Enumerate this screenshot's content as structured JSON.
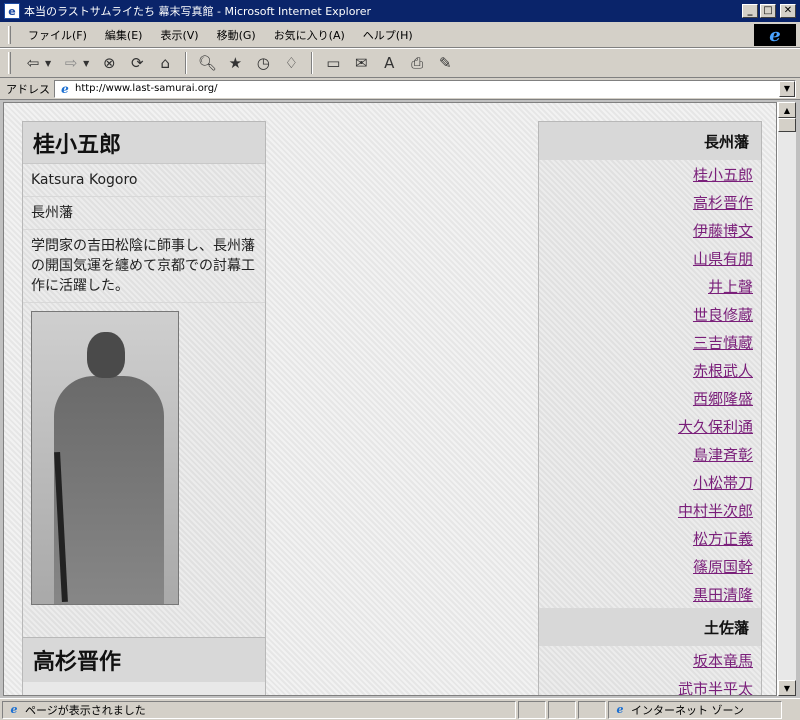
{
  "window": {
    "title": "本当のラストサムライたち 幕末写真館 - Microsoft Internet Explorer",
    "minimize": "_",
    "maximize": "□",
    "close": "✕"
  },
  "menu": {
    "items": [
      "ファイル(F)",
      "編集(E)",
      "表示(V)",
      "移動(G)",
      "お気に入り(A)",
      "ヘルプ(H)"
    ]
  },
  "toolbar": {
    "buttons": [
      "back-icon",
      "forward-icon",
      "stop-icon",
      "refresh-icon",
      "home-icon",
      "search-icon",
      "favorites-icon",
      "history-icon",
      "channels-icon",
      "fullscreen-icon",
      "mail-icon",
      "font-icon",
      "print-icon",
      "edit-icon"
    ]
  },
  "address": {
    "label": "アドレス",
    "url": "http://www.last-samurai.org/"
  },
  "profile": {
    "name": "桂小五郎",
    "romaji": "Katsura Kogoro",
    "domain": "長州藩",
    "description": "学問家の吉田松陰に師事し、長州藩の開国気運を纏めて京都での討幕工作に活躍した。",
    "next_name": "高杉晋作"
  },
  "nav": {
    "groups": [
      {
        "title": "長州藩",
        "links": [
          "桂小五郎",
          "高杉晋作",
          "伊藤博文",
          "山県有朋",
          "井上聲",
          "世良修蔵",
          "三吉慎蔵",
          "赤根武人",
          "西郷隆盛",
          "大久保利通",
          "島津斉彰",
          "小松帯刀",
          "中村半次郎",
          "松方正義",
          "篠原国幹",
          "黒田清隆"
        ]
      },
      {
        "title": "土佐藩",
        "links": [
          "坂本竜馬",
          "武市半平太"
        ]
      }
    ]
  },
  "status": {
    "text": "ページが表示されました",
    "zone": "インターネット ゾーン"
  },
  "colors": {
    "titlebar": "#0a246a",
    "link": "#7a1f7a",
    "chrome": "#d4d0c8"
  }
}
